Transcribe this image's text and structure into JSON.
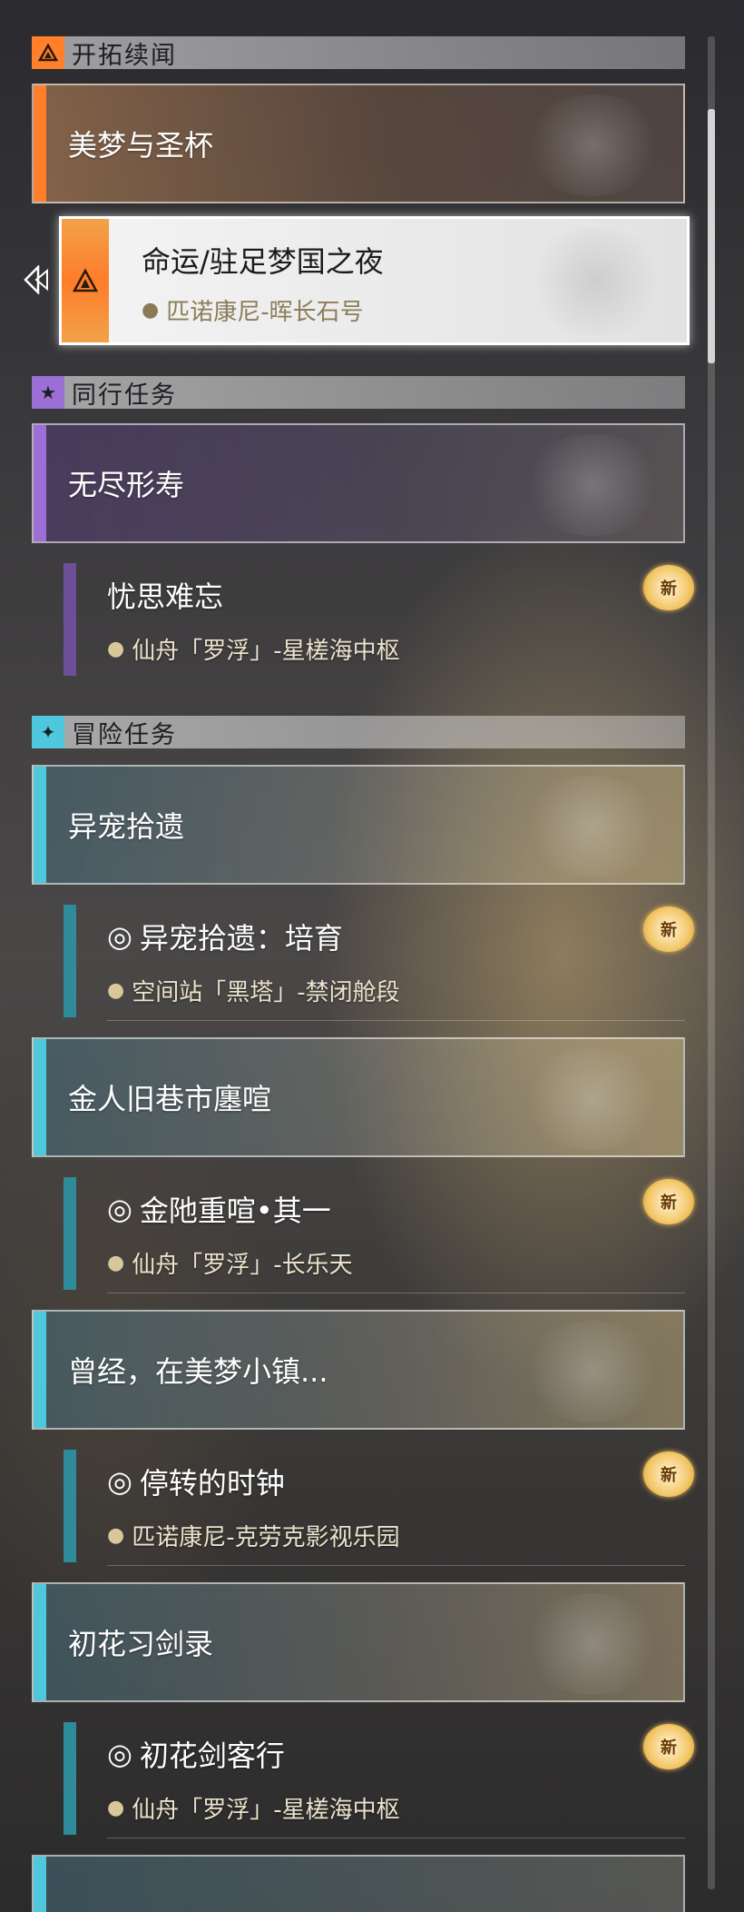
{
  "colors": {
    "trailblaze": "#ff7f2a",
    "companion": "#9b6fd6",
    "adventure": "#4fc7dc"
  },
  "icons": {
    "trailblaze_badge": "trailblaze-triangle-icon",
    "companion_badge": "star-icon",
    "adventure_badge": "sparkle-icon",
    "location": "location-pin-icon",
    "quest": "quest-swirl-icon",
    "selection": "selection-pointer-icon"
  },
  "sections": {
    "trailblaze": {
      "header": "开拓续闻",
      "main_title": "美梦与圣杯",
      "selected": {
        "name": "命运/驻足梦国之夜",
        "location": "匹诺康尼-晖长石号"
      }
    },
    "companion": {
      "header": "同行任务",
      "main_title": "无尽形寿",
      "sub": {
        "name": "忧思难忘",
        "location": "仙舟「罗浮」-星槎海中枢",
        "badge": "新"
      }
    },
    "adventure": {
      "header": "冒险任务",
      "groups": [
        {
          "title": "异宠拾遗",
          "sub_name": "异宠拾遗：培育",
          "sub_location": "空间站「黑塔」-禁闭舱段",
          "badge": "新"
        },
        {
          "title": "金人旧巷市廛喧",
          "sub_name": "金阤重喧•其一",
          "sub_location": "仙舟「罗浮」-长乐天",
          "badge": "新"
        },
        {
          "title": "曾经，在美梦小镇...",
          "sub_name": "停转的时钟",
          "sub_location": "匹诺康尼-克劳克影视乐园",
          "badge": "新"
        },
        {
          "title": "初花习剑录",
          "sub_name": "初花剑客行",
          "sub_location": "仙舟「罗浮」-星槎海中枢",
          "badge": "新"
        }
      ]
    }
  }
}
